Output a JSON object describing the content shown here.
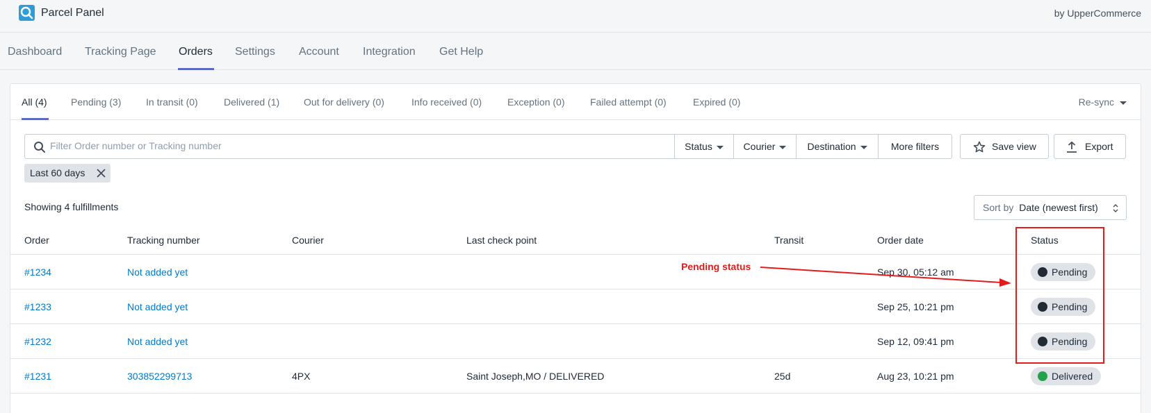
{
  "app": {
    "title": "Parcel Panel",
    "by": "by UpperCommerce"
  },
  "nav": {
    "items": [
      {
        "label": "Dashboard"
      },
      {
        "label": "Tracking Page"
      },
      {
        "label": "Orders",
        "active": true
      },
      {
        "label": "Settings"
      },
      {
        "label": "Account"
      },
      {
        "label": "Integration"
      },
      {
        "label": "Get Help"
      }
    ]
  },
  "tabs": {
    "items": [
      {
        "label": "All (4)",
        "active": true
      },
      {
        "label": "Pending (3)"
      },
      {
        "label": "In transit (0)"
      },
      {
        "label": "Delivered (1)"
      },
      {
        "label": "Out for delivery (0)"
      },
      {
        "label": "Info received (0)"
      },
      {
        "label": "Exception (0)"
      },
      {
        "label": "Failed attempt (0)"
      },
      {
        "label": "Expired (0)"
      }
    ],
    "resync": "Re-sync"
  },
  "filters": {
    "search_placeholder": "Filter Order number or Tracking number",
    "status": "Status",
    "courier": "Courier",
    "destination": "Destination",
    "more": "More filters",
    "save_view": "Save view",
    "export": "Export",
    "chip": "Last 60 days"
  },
  "summary": {
    "showing": "Showing 4 fulfillments",
    "sort_label": "Sort by",
    "sort_value": "Date (newest first)"
  },
  "table": {
    "columns": [
      "Order",
      "Tracking number",
      "Courier",
      "Last check point",
      "Transit",
      "Order date",
      "Status"
    ],
    "rows": [
      {
        "order": "#1234",
        "tracking": "Not added yet",
        "courier": "",
        "checkpoint": "",
        "transit": "",
        "date": "Sep 30, 05:12 am",
        "status": "Pending"
      },
      {
        "order": "#1233",
        "tracking": "Not added yet",
        "courier": "",
        "checkpoint": "",
        "transit": "",
        "date": "Sep 25, 10:21 pm",
        "status": "Pending"
      },
      {
        "order": "#1232",
        "tracking": "Not added yet",
        "courier": "",
        "checkpoint": "",
        "transit": "",
        "date": "Sep 12, 09:41 pm",
        "status": "Pending"
      },
      {
        "order": "#1231",
        "tracking": "303852299713",
        "courier": "4PX",
        "checkpoint": "Saint Joseph,MO / DELIVERED",
        "transit": "25d",
        "date": "Aug 23, 10:21 pm",
        "status": "Delivered"
      }
    ]
  },
  "annotation": {
    "label": "Pending status",
    "color": "#e41b1b"
  },
  "colors": {
    "accent": "#5c6ac4",
    "link": "#007ace",
    "delivered": "#22a24a"
  }
}
